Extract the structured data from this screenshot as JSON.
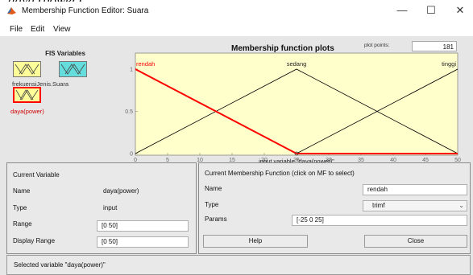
{
  "page_caption_fragment": "daya (power).",
  "window": {
    "title": "Membership Function Editor: Suara",
    "minimize": "—",
    "maximize": "☐",
    "close": "✕"
  },
  "menu": [
    "File",
    "Edit",
    "View"
  ],
  "fis_variables": {
    "title": "FIS Variables",
    "input_label": "frekuensiJenis.Suara",
    "output_label": "daya(power)"
  },
  "plot": {
    "title": "Membership function plots",
    "plot_points_label": "plot points:",
    "plot_points_value": "181",
    "xlabel": "input variable \"daya(power)\""
  },
  "chart_data": {
    "type": "line",
    "xlim": [
      0,
      50
    ],
    "ylim": [
      0,
      1
    ],
    "x_ticks": [
      "0",
      "5",
      "10",
      "15",
      "20",
      "25",
      "30",
      "35",
      "40",
      "45",
      "50"
    ],
    "y_ticks": [
      "0",
      "0.5",
      "1"
    ],
    "series": [
      {
        "name": "rendah",
        "x": [
          -25,
          0,
          25
        ],
        "y": [
          0,
          1,
          0
        ],
        "color": "#ff0000",
        "selected": true
      },
      {
        "name": "sedang",
        "x": [
          0,
          25,
          50
        ],
        "y": [
          0,
          1,
          0
        ],
        "color": "#000000"
      },
      {
        "name": "tinggi",
        "x": [
          25,
          50,
          75
        ],
        "y": [
          0,
          1,
          0
        ],
        "color": "#000000"
      }
    ]
  },
  "current_variable": {
    "title": "Current Variable",
    "name_label": "Name",
    "name_value": "daya(power)",
    "type_label": "Type",
    "type_value": "input",
    "range_label": "Range",
    "range_value": "[0 50]",
    "display_range_label": "Display Range",
    "display_range_value": "[0 50]"
  },
  "current_mf": {
    "title": "Current Membership Function (click on MF to select)",
    "name_label": "Name",
    "name_value": "rendah",
    "type_label": "Type",
    "type_value": "trimf",
    "params_label": "Params",
    "params_value": "[-25 0 25]"
  },
  "buttons": {
    "help": "Help",
    "close": "Close"
  },
  "status": "Selected variable \"daya(power)\"",
  "colors": {
    "plot_bg": "#ffffcc",
    "selected": "#ff0000",
    "fis_box": "#ffff99",
    "fis_box_output_border": "#ff0000",
    "fis_box_input_alt": "#66dddd"
  }
}
